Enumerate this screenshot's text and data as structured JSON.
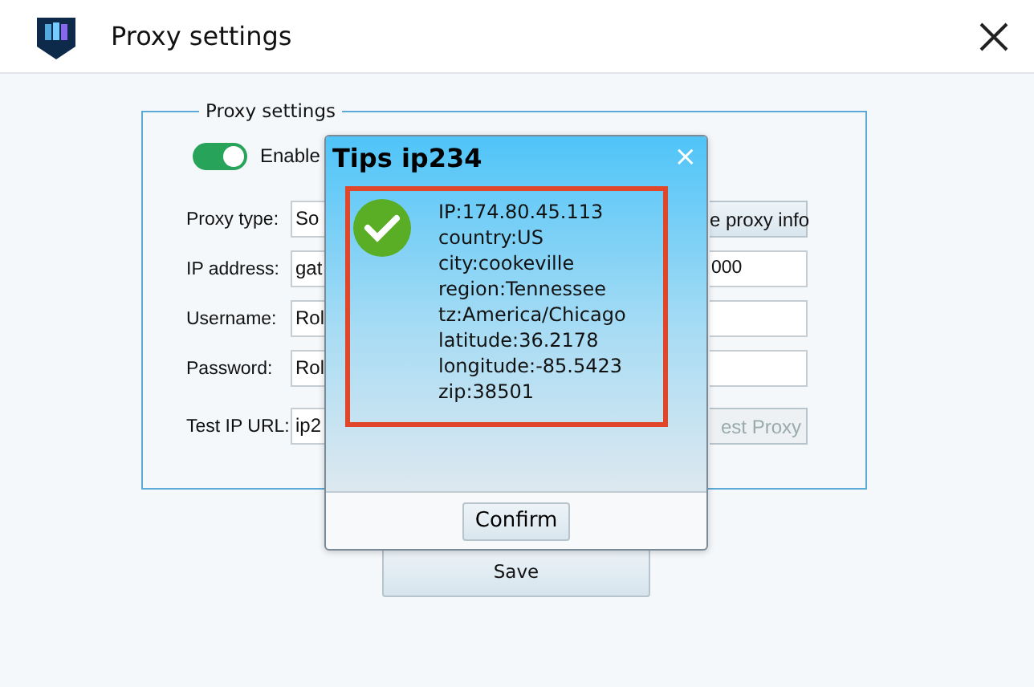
{
  "window": {
    "title": "Proxy settings"
  },
  "proxy_settings": {
    "title": "Proxy settings",
    "enable": {
      "label": "Enable",
      "on": true
    },
    "rows": [
      {
        "label": "Proxy type:",
        "value": "So",
        "right": {
          "kind": "button",
          "text": "e proxy info",
          "disabled": false
        }
      },
      {
        "label": "IP address:",
        "value": "gat",
        "right": {
          "kind": "field",
          "text": "000"
        }
      },
      {
        "label": "Username:",
        "value": "Rol",
        "right": {
          "kind": "field"
        }
      },
      {
        "label": "Password:",
        "value": "Rol",
        "right": {
          "kind": "field"
        }
      },
      {
        "label": "Test IP URL:",
        "value": "ip2",
        "right": {
          "kind": "button",
          "text": "est Proxy",
          "disabled": true
        }
      }
    ]
  },
  "dialog": {
    "title": "Tips ip234",
    "close": "×",
    "lines": [
      "IP:174.80.45.113",
      "country:US",
      "city:cookeville",
      "region:Tennessee",
      "tz:America/Chicago",
      "latitude:36.2178",
      "longitude:-85.5423",
      "zip:38501"
    ],
    "confirm": "Confirm"
  },
  "save_button": "Save"
}
